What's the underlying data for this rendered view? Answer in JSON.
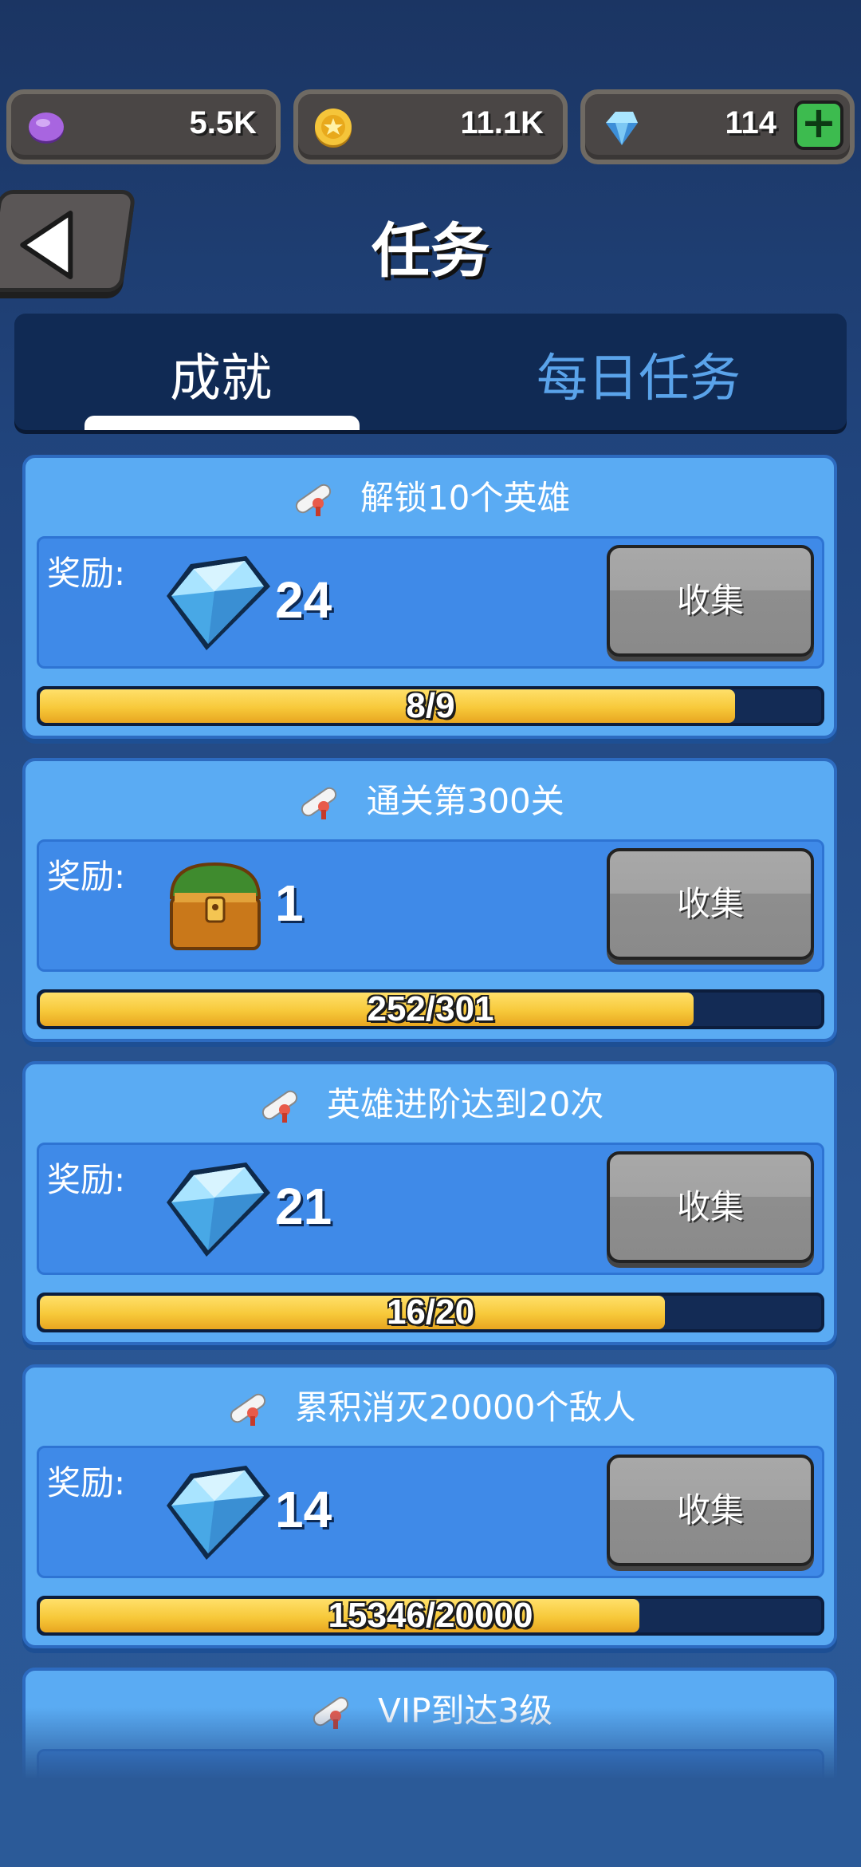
{
  "currencies": [
    {
      "name": "purple-gem",
      "value": "5.5K",
      "color": "#9b59d6"
    },
    {
      "name": "gold-coin",
      "value": "11.1K",
      "color": "#f2c230"
    },
    {
      "name": "diamond",
      "value": "114",
      "color": "#6fd0f7",
      "plus": "+"
    }
  ],
  "header": {
    "title": "任务"
  },
  "tabs": [
    {
      "label": "成就",
      "active": true
    },
    {
      "label": "每日任务",
      "active": false
    }
  ],
  "reward_label": "奖励:",
  "collect_label": "收集",
  "tasks": [
    {
      "title": "解锁10个英雄",
      "reward_icon": "diamond-icon",
      "reward_qty": "24",
      "progress_text": "8/9",
      "progress_fraction": 0.89
    },
    {
      "title": "通关第300关",
      "reward_icon": "treasure-chest-icon",
      "reward_qty": "1",
      "progress_text": "252/301",
      "progress_fraction": 0.837
    },
    {
      "title": "英雄进阶达到20次",
      "reward_icon": "diamond-icon",
      "reward_qty": "21",
      "progress_text": "16/20",
      "progress_fraction": 0.8
    },
    {
      "title": "累积消灭20000个敌人",
      "reward_icon": "diamond-icon",
      "reward_qty": "14",
      "progress_text": "15346/20000",
      "progress_fraction": 0.767
    },
    {
      "title": "VIP到达3级"
    }
  ],
  "colors": {
    "card_bg": "#5aabf3",
    "panel_bg": "#3f8ae8",
    "progress_fill": "#f7c93a",
    "tab_active": "#ffffff",
    "tab_inactive": "#5aa3ea"
  }
}
